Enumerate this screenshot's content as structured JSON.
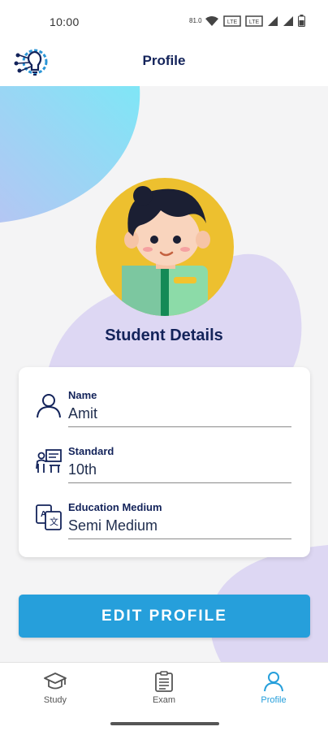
{
  "status_bar": {
    "time": "10:00",
    "icons": [
      "data-speed-icon",
      "wifi-icon",
      "volte-icon",
      "volte-icon",
      "signal-icon",
      "signal-icon",
      "battery-icon"
    ],
    "speed_text": "81.0"
  },
  "app_bar": {
    "title": "Profile",
    "logo_icon": "lightbulb-gear-icon"
  },
  "profile": {
    "section_title": "Student Details",
    "fields": [
      {
        "label": "Name",
        "value": "Amit",
        "icon": "user-icon"
      },
      {
        "label": "Standard",
        "value": "10th",
        "icon": "classroom-icon"
      },
      {
        "label": "Education Medium",
        "value": "Semi Medium",
        "icon": "translate-icon"
      }
    ],
    "edit_button_label": "EDIT PROFILE"
  },
  "bottom_nav": {
    "items": [
      {
        "label": "Study",
        "icon": "graduation-cap-icon",
        "active": false
      },
      {
        "label": "Exam",
        "icon": "clipboard-icon",
        "active": false
      },
      {
        "label": "Profile",
        "icon": "user-icon",
        "active": true
      }
    ]
  },
  "colors": {
    "primary": "#269fdb",
    "title_text": "#13235a",
    "background": "#f4f4f5",
    "blob_blue": "#8be3f5",
    "blob_purple": "#ddd7f3",
    "avatar_bg": "#edc02f"
  }
}
